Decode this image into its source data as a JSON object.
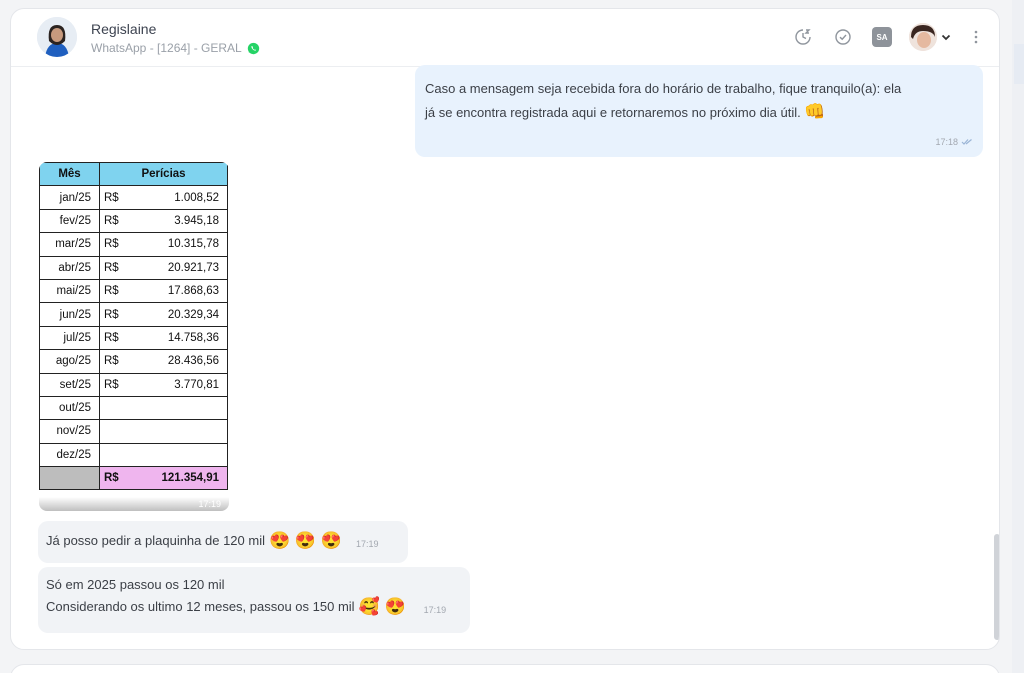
{
  "header": {
    "contact_name": "Regislaine",
    "contact_sub": "WhatsApp - [1264] - GERAL"
  },
  "icons": {
    "snooze": "clock-snooze-icon",
    "resolve": "check-circle-icon",
    "whatsapp": "whatsapp-icon",
    "more": "more-vertical-icon",
    "agent_dropdown": "chevron-down-icon"
  },
  "agent_badge": "SA",
  "colors": {
    "outgoing_bubble": "#e8f2fd",
    "incoming_bubble": "#f1f3f6",
    "whatsapp_green": "#25d366",
    "sheet_header": "#7fd3ef",
    "sheet_total": "#efb5ee"
  },
  "messages": {
    "auto_reply": {
      "text": "Caso a mensagem seja recebida fora do horário de trabalho, fique tranquilo(a): ela já se encontra registrada aqui e retornaremos no próximo dia útil.",
      "emoji": "👊",
      "time": "17:18"
    },
    "image": {
      "time": "17:19",
      "sheet": {
        "headers": [
          "Mês",
          "Perícias"
        ],
        "currency": "R$",
        "rows": [
          {
            "month": "jan/25",
            "value": "1.008,52"
          },
          {
            "month": "fev/25",
            "value": "3.945,18"
          },
          {
            "month": "mar/25",
            "value": "10.315,78"
          },
          {
            "month": "abr/25",
            "value": "20.921,73"
          },
          {
            "month": "mai/25",
            "value": "17.868,63"
          },
          {
            "month": "jun/25",
            "value": "20.329,34"
          },
          {
            "month": "jul/25",
            "value": "14.758,36"
          },
          {
            "month": "ago/25",
            "value": "28.436,56"
          },
          {
            "month": "set/25",
            "value": "3.770,81"
          },
          {
            "month": "out/25",
            "value": ""
          },
          {
            "month": "nov/25",
            "value": ""
          },
          {
            "month": "dez/25",
            "value": ""
          }
        ],
        "total": "121.354,91"
      }
    },
    "msg1": {
      "text": "Já posso pedir a plaquinha de 120 mil",
      "emojis": "😍 😍 😍",
      "time": "17:19"
    },
    "msg2": {
      "line1": "Só em 2025 passou os 120 mil",
      "line2": "Considerando os ultimo 12 meses, passou os 150 mil",
      "emojis": "🥰 😍",
      "time": "17:19"
    }
  }
}
